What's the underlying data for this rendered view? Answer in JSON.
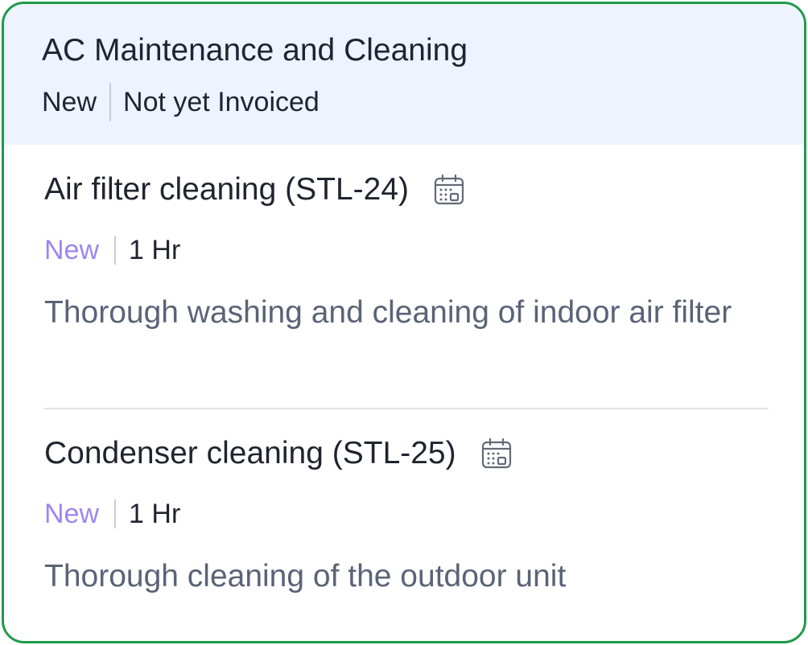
{
  "order": {
    "title": "AC Maintenance and Cleaning",
    "status": "New",
    "invoice_status": "Not yet Invoiced"
  },
  "services": [
    {
      "title": "Air filter cleaning (STL-24)",
      "icon": "calendar-icon",
      "status": "New",
      "duration": "1 Hr",
      "description": "Thorough washing and cleaning of indoor air filter"
    },
    {
      "title": "Condenser cleaning (STL-25)",
      "icon": "calendar-icon",
      "status": "New",
      "duration": "1 Hr",
      "description": "Thorough cleaning of the outdoor unit"
    }
  ],
  "colors": {
    "card_border": "#1f9a4a",
    "header_bg": "#edf3ff",
    "status_accent": "#9b87ec",
    "description_text": "#5a6377"
  }
}
